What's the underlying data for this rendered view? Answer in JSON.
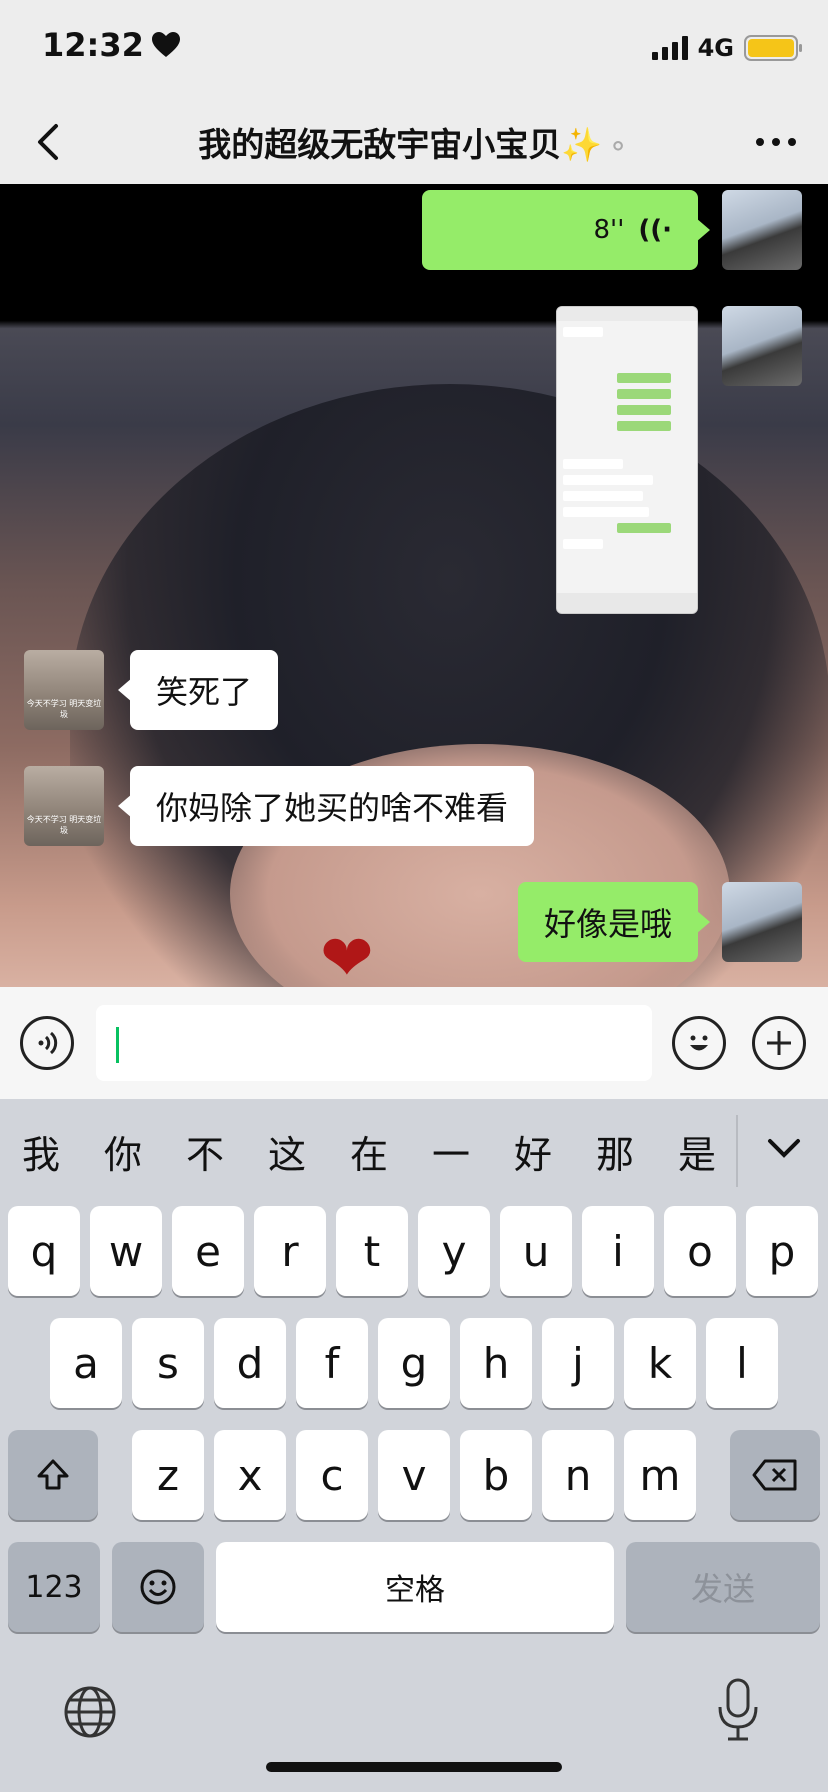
{
  "status_bar": {
    "time": "12:32",
    "network": "4G",
    "battery_color": "#f5c518"
  },
  "nav": {
    "title": "我的超级无敌宇宙小宝贝",
    "title_emoji": "✨",
    "ear_icon": "👂"
  },
  "messages": [
    {
      "side": "me",
      "type": "voice",
      "duration": "8''"
    },
    {
      "side": "me",
      "type": "image"
    },
    {
      "side": "other",
      "type": "text",
      "text": "笑死了"
    },
    {
      "side": "other",
      "type": "text",
      "text": "你妈除了她买的啥不难看"
    },
    {
      "side": "me",
      "type": "text",
      "text": "好像是哦"
    }
  ],
  "avatar_other_caption": "今天不学习 明天变垃圾",
  "sticker": "❤",
  "input_bar": {
    "value": ""
  },
  "candidates": [
    "我",
    "你",
    "不",
    "这",
    "在",
    "一",
    "好",
    "那",
    "是"
  ],
  "keyboard": {
    "row1": [
      "q",
      "w",
      "e",
      "r",
      "t",
      "y",
      "u",
      "i",
      "o",
      "p"
    ],
    "row2": [
      "a",
      "s",
      "d",
      "f",
      "g",
      "h",
      "j",
      "k",
      "l"
    ],
    "row3": [
      "z",
      "x",
      "c",
      "v",
      "b",
      "n",
      "m"
    ],
    "num_label": "123",
    "space_label": "空格",
    "send_label": "发送"
  },
  "colors": {
    "my_bubble": "#95ec69",
    "other_bubble": "#ffffff",
    "caret": "#07c160"
  }
}
